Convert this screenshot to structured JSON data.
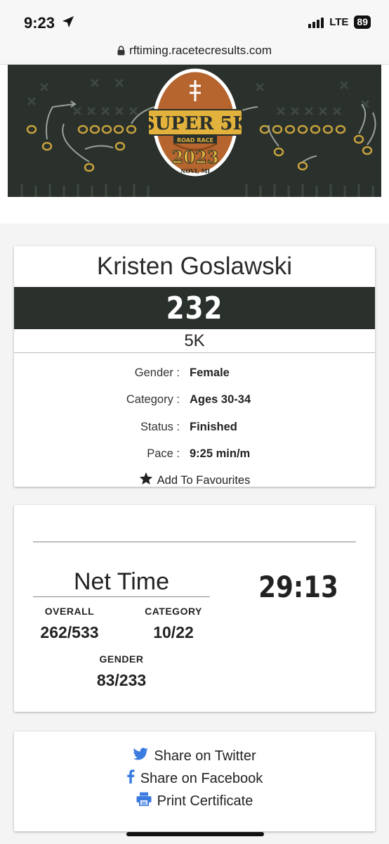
{
  "status_bar": {
    "time": "9:23",
    "network": "LTE",
    "battery": "89"
  },
  "browser": {
    "url": "rftiming.racetecresults.com"
  },
  "banner": {
    "logo_word": "SUPER 5K",
    "logo_sub": "ROAD RACE",
    "logo_year": "2023",
    "logo_place": "NOVI, MI",
    "colors": {
      "bg": "#2a302b",
      "ball": "#b5652d",
      "gold": "#e3b23c"
    }
  },
  "athlete": {
    "name": "Kristen Goslawski",
    "bib": "232",
    "race": "5K",
    "details": [
      {
        "label": "Gender :",
        "value": "Female"
      },
      {
        "label": "Category :",
        "value": "Ages 30-34"
      },
      {
        "label": "Status :",
        "value": "Finished"
      },
      {
        "label": "Pace :",
        "value": "9:25 min/m"
      }
    ],
    "favourite_label": "Add To Favourites"
  },
  "results": {
    "net_time_label": "Net Time",
    "net_time": "29:13",
    "overall_label": "OVERALL",
    "overall": "262/533",
    "category_label": "CATEGORY",
    "category": "10/22",
    "gender_label": "GENDER",
    "gender": "83/233"
  },
  "share": {
    "twitter": "Share on Twitter",
    "facebook": "Share on Facebook",
    "certificate": "Print Certificate",
    "icon_color": "#3b7be0"
  }
}
